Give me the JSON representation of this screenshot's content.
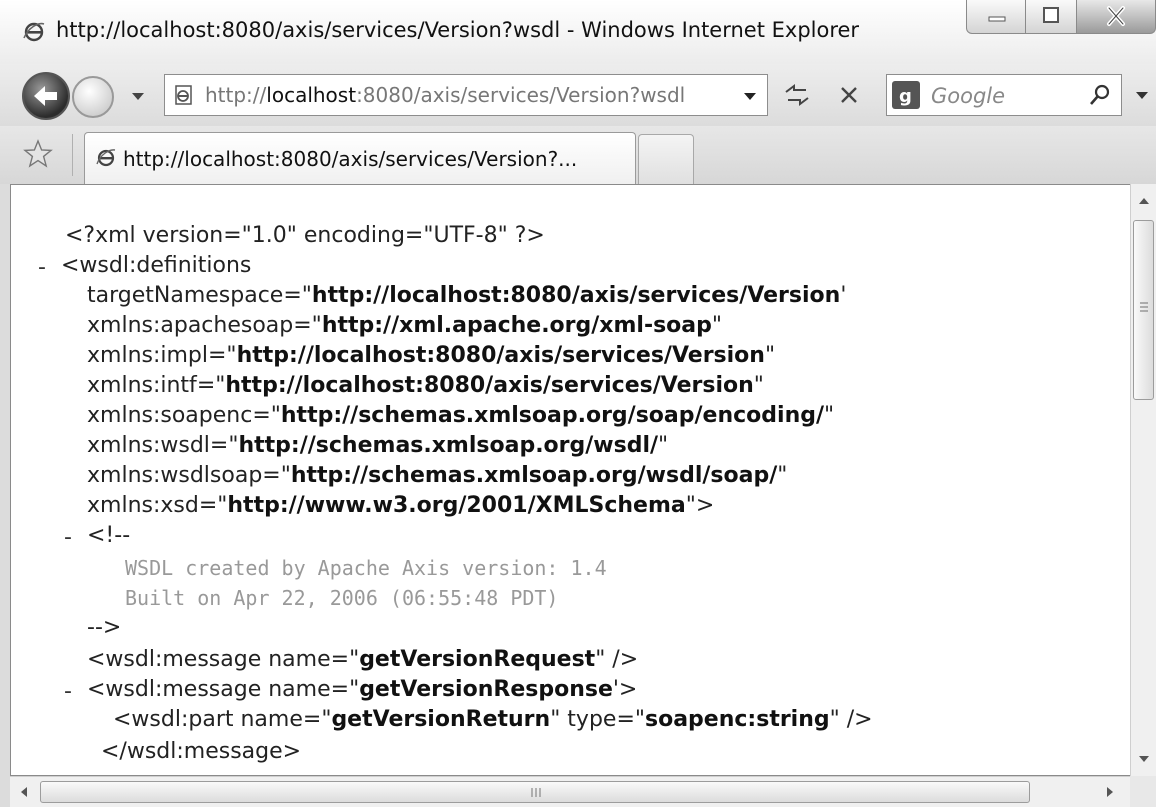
{
  "window": {
    "title": "http://localhost:8080/axis/services/Version?wsdl - Windows Internet Explorer"
  },
  "navbar": {
    "address_prefix": "http://",
    "address_host": "localhost",
    "address_rest": ":8080/axis/services/Version?wsdl",
    "search_placeholder": "Google"
  },
  "tabs": [
    {
      "title": "http://localhost:8080/axis/services/Version?...",
      "active": true
    }
  ],
  "xml": {
    "declaration": "<?xml version=\"1.0\" encoding=\"UTF-8\" ?>",
    "definitions_open": "<wsdl:definitions",
    "attributes": [
      {
        "name": "targetNamespace",
        "value": "http://localhost:8080/axis/services/Version",
        "close": "'"
      },
      {
        "name": "xmlns:apachesoap",
        "value": "http://xml.apache.org/xml-soap",
        "close": "\""
      },
      {
        "name": "xmlns:impl",
        "value": "http://localhost:8080/axis/services/Version",
        "close": "\""
      },
      {
        "name": "xmlns:intf",
        "value": "http://localhost:8080/axis/services/Version",
        "close": "\""
      },
      {
        "name": "xmlns:soapenc",
        "value": "http://schemas.xmlsoap.org/soap/encoding/",
        "close": "\""
      },
      {
        "name": "xmlns:wsdl",
        "value": "http://schemas.xmlsoap.org/wsdl/",
        "close": "\""
      },
      {
        "name": "xmlns:wsdlsoap",
        "value": "http://schemas.xmlsoap.org/wsdl/soap/",
        "close": "\""
      },
      {
        "name": "xmlns:xsd",
        "value": "http://www.w3.org/2001/XMLSchema",
        "close": "\">"
      }
    ],
    "comment_open": "<!--",
    "comment_lines": [
      "WSDL created by Apache Axis version: 1.4",
      "Built on Apr 22, 2006 (06:55:48 PDT)"
    ],
    "comment_close": "-->",
    "message1": {
      "prefix": "<wsdl:message name=\"",
      "name": "getVersionRequest",
      "suffix": "\" />"
    },
    "message2": {
      "prefix": "<wsdl:message name=\"",
      "name": "getVersionResponse",
      "suffix": "'>"
    },
    "part": {
      "prefix": "<wsdl:part name=\"",
      "name": "getVersionReturn",
      "mid": "\" type=\"",
      "type": "soapenc:string",
      "suffix": "\" />"
    },
    "message_close": "</wsdl:message>",
    "collapse_marker": "-"
  },
  "colors": {
    "comment": "#999999",
    "attribute_value": "#111111"
  }
}
